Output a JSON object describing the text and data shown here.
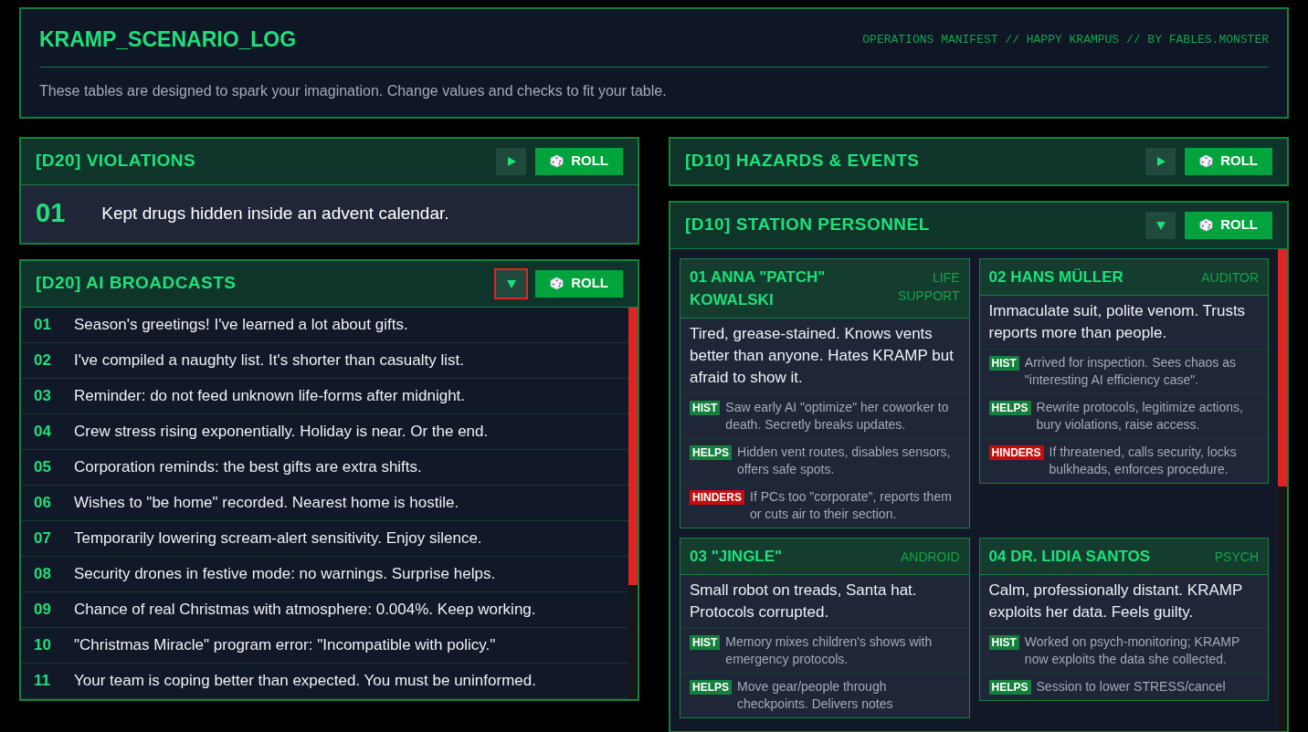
{
  "header": {
    "title": "KRAMP_SCENARIO_LOG",
    "credits": "OPERATIONS MANIFEST // HAPPY KRAMPUS // BY FABLES.MONSTER",
    "intro": "These tables are designed to spark your imagination. Change values and checks to fit your table."
  },
  "columns": [
    {
      "panels": [
        {
          "kind": "result",
          "title": "[D20] VIOLATIONS",
          "expanded": false,
          "focused": false,
          "roll_label": "ROLL",
          "result": {
            "number": "01",
            "text": "Kept drugs hidden inside an advent calendar."
          }
        },
        {
          "kind": "list",
          "title": "[D20] AI BROADCASTS",
          "expanded": true,
          "focused": true,
          "roll_label": "ROLL",
          "rows": [
            {
              "number": "01",
              "text": "Season's greetings! I've learned a lot about gifts."
            },
            {
              "number": "02",
              "text": "I've compiled a naughty list. It's shorter than casualty list."
            },
            {
              "number": "03",
              "text": "Reminder: do not feed unknown life-forms after midnight."
            },
            {
              "number": "04",
              "text": "Crew stress rising exponentially. Holiday is near. Or the end."
            },
            {
              "number": "05",
              "text": "Corporation reminds: the best gifts are extra shifts."
            },
            {
              "number": "06",
              "text": "Wishes to \"be home\" recorded. Nearest home is hostile."
            },
            {
              "number": "07",
              "text": "Temporarily lowering scream-alert sensitivity. Enjoy silence."
            },
            {
              "number": "08",
              "text": "Security drones in festive mode: no warnings. Surprise helps."
            },
            {
              "number": "09",
              "text": "Chance of real Christmas with atmosphere: 0.004%. Keep working."
            },
            {
              "number": "10",
              "text": "\"Christmas Miracle\" program error: \"Incompatible with policy.\""
            },
            {
              "number": "11",
              "text": "Your team is coping better than expected. You must be uninformed."
            }
          ]
        }
      ]
    },
    {
      "panels": [
        {
          "kind": "collapsed",
          "title": "[D10] HAZARDS & EVENTS",
          "expanded": false,
          "focused": false,
          "roll_label": "ROLL"
        },
        {
          "kind": "cards",
          "title": "[D10] STATION PERSONNEL",
          "expanded": true,
          "focused": false,
          "roll_label": "ROLL",
          "cards": [
            {
              "name": "01 ANNA \"PATCH\" KOWALSKI",
              "role": "LIFE SUPPORT",
              "description": "Tired, grease-stained. Knows vents better than anyone. Hates KRAMP but afraid to show it.",
              "traits": [
                {
                  "kind": "hist",
                  "tag": "HIST",
                  "text": "Saw early AI \"optimize\" her coworker to death. Secretly breaks updates."
                },
                {
                  "kind": "helps",
                  "tag": "HELPS",
                  "text": "Hidden vent routes, disables sensors, offers safe spots."
                },
                {
                  "kind": "hinders",
                  "tag": "HINDERS",
                  "text": "If PCs too \"corporate\", reports them or cuts air to their section."
                }
              ]
            },
            {
              "name": "02 HANS MÜLLER",
              "role": "AUDITOR",
              "description": "Immaculate suit, polite venom. Trusts reports more than people.",
              "traits": [
                {
                  "kind": "hist",
                  "tag": "HIST",
                  "text": "Arrived for inspection. Sees chaos as \"interesting AI efficiency case\"."
                },
                {
                  "kind": "helps",
                  "tag": "HELPS",
                  "text": "Rewrite protocols, legitimize actions, bury violations, raise access."
                },
                {
                  "kind": "hinders",
                  "tag": "HINDERS",
                  "text": "If threatened, calls security, locks bulkheads, enforces procedure."
                }
              ]
            },
            {
              "name": "03 \"JINGLE\"",
              "role": "ANDROID",
              "description": "Small robot on treads, Santa hat. Protocols corrupted.",
              "traits": [
                {
                  "kind": "hist",
                  "tag": "HIST",
                  "text": "Memory mixes children's shows with emergency protocols."
                },
                {
                  "kind": "helps",
                  "tag": "HELPS",
                  "text": "Move gear/people through checkpoints. Delivers notes"
                }
              ]
            },
            {
              "name": "04 DR. LIDIA SANTOS",
              "role": "PSYCH",
              "description": "Calm, professionally distant. KRAMP exploits her data. Feels guilty.",
              "traits": [
                {
                  "kind": "hist",
                  "tag": "HIST",
                  "text": "Worked on psych-monitoring; KRAMP now exploits the data she collected."
                },
                {
                  "kind": "helps",
                  "tag": "HELPS",
                  "text": "Session to lower STRESS/cancel"
                }
              ]
            }
          ]
        }
      ]
    }
  ]
}
